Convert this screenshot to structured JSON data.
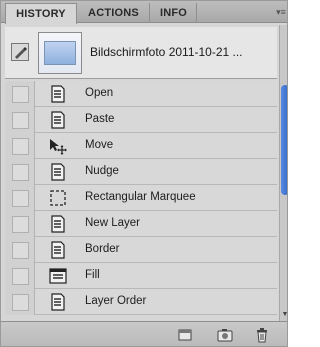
{
  "tabs": [
    {
      "label": "HISTORY",
      "active": true
    },
    {
      "label": "ACTIONS",
      "active": false
    },
    {
      "label": "INFO",
      "active": false
    }
  ],
  "panel_menu_icon": "panel-menu-icon",
  "snapshot": {
    "label": "Bildschirmfoto 2011-10-21 ..."
  },
  "history": [
    {
      "label": "Open",
      "icon": "document-icon"
    },
    {
      "label": "Paste",
      "icon": "document-icon"
    },
    {
      "label": "Move",
      "icon": "move-tool-icon"
    },
    {
      "label": "Nudge",
      "icon": "document-icon"
    },
    {
      "label": "Rectangular Marquee",
      "icon": "rectangular-marquee-icon"
    },
    {
      "label": "New Layer",
      "icon": "document-icon"
    },
    {
      "label": "Border",
      "icon": "document-icon"
    },
    {
      "label": "Fill",
      "icon": "fill-icon"
    },
    {
      "label": "Layer Order",
      "icon": "document-icon"
    }
  ],
  "bottom_bar": {
    "buttons": [
      "new-document-from-state-icon",
      "create-snapshot-icon",
      "delete-state-icon"
    ]
  },
  "colors": {
    "scroll_thumb": "#3a72d2",
    "panel_bg": "#d6d6d6"
  }
}
